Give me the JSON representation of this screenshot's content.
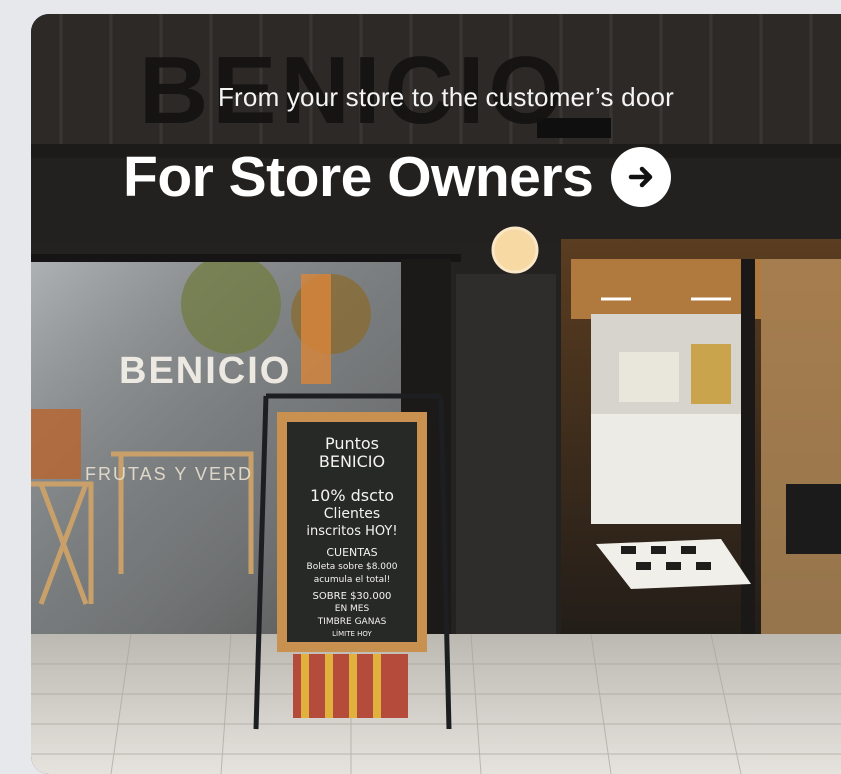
{
  "hero": {
    "subtitle": "From your store to the customer’s door",
    "title": "For Store Owners",
    "arrow_icon": "arrow-right-circle-icon"
  },
  "storefront": {
    "sign": "BENICIO",
    "window_logo": "BENICIO",
    "window_text": "FRUTAS Y VERD"
  },
  "chalkboard": {
    "lines": [
      "Puntos",
      "BENICIO",
      "10% dscto",
      "Clientes",
      "inscritos HOY!",
      "CUENTAS",
      "Boleta sobre $8.000",
      "acumula el total!",
      "SOBRE $30.000",
      "EN MES",
      "TIMBRE GANAS",
      "LÍMITE HOY"
    ]
  }
}
